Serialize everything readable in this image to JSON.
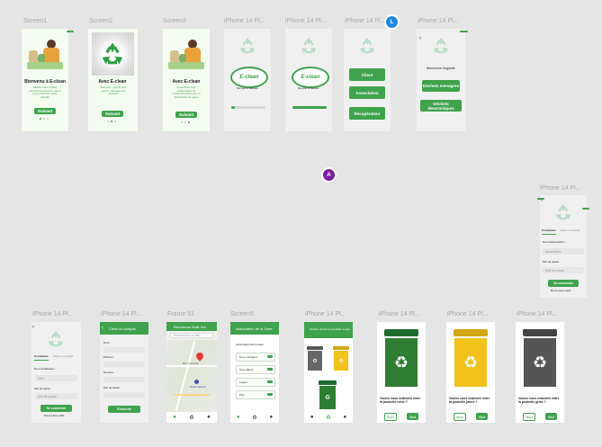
{
  "labels": {
    "screen1": "Screen1",
    "screen2": "Screen2",
    "screen3": "Screen3",
    "iphone1": "iPhone 14 Pl...",
    "iphone2": "iPhone 14 Pl...",
    "iphone3": "iPhone 14 Pl...",
    "iphone4": "iPhone 14 Pl...",
    "iphone_right": "iPhone 14 Pl...",
    "iphone5": "iPhone 14 Pl...",
    "iphone6": "iPhone 14 Pl...",
    "frame51": "Frame 51",
    "screen5": "Screen5",
    "iphone7": "iPhone 14 Pl...",
    "iphone8": "iPhone 14 Pl...",
    "iphone9": "iPhone 14 Pl...",
    "iphone10": "iPhone 14 Pl..."
  },
  "avatars": {
    "l": "L",
    "a": "A"
  },
  "colors": {
    "green": "#3fa34d",
    "avatar_l": "#1e88e5",
    "avatar_a": "#7b1fa2",
    "canvas": "#e5e5e5"
  },
  "onboarding": {
    "s1_title": "Bienvenu à E-clean",
    "s1_body": "Mettre votre impact environnemental en valeur pour préserver notre planète",
    "s2_title": "Avec E-clean",
    "s2_body": "Recycler, gagner des points, valoriser des déchets",
    "s3_title": "Avec E-clean",
    "s3_body": "Contribuez à la préservation de l'environnement tout en bénéficiant de gains",
    "next": "Suivant"
  },
  "logo_text": "E-clean",
  "logo_tagline": "Recyclez et valorisez",
  "roles": {
    "client": "Client",
    "association": "Association",
    "recuperateur": "Récupérateur"
  },
  "welcome": {
    "greeting": "Bienvenue Huguette",
    "menagers": "Déchets ménagers",
    "electroniques": "Déchets électroniques"
  },
  "login_right": {
    "tab_login": "Connexion",
    "tab_create": "Créer un compte",
    "name_label": "Nom d'association :",
    "name_ph": "Association",
    "pass_label": "Mot de passe :",
    "pass_ph": "Mot de passe",
    "submit": "Se connecter",
    "forgot": "Mot de passe oublié"
  },
  "login_left": {
    "tab_login": "Connexion",
    "tab_create": "Créer un compte",
    "user_label": "Nom d'utilisateur :",
    "user_ph": "Nom",
    "pass_label": "Mot de passe :",
    "pass_ph": "Mot de passe",
    "submit": "Se connecter",
    "forgot": "Mot de passe oublié"
  },
  "signup": {
    "title": "Créer un compte",
    "nom": "Nom :",
    "prenom": "Prénom :",
    "numero": "Numéro :",
    "pass": "Mot de passe :",
    "submit": "S'inscrire"
  },
  "map": {
    "header": "Bienvenue Sidik Sia",
    "search": "Rechercher un lieu",
    "place": "Mont Cameroun",
    "poi": "Musée National"
  },
  "assoc": {
    "title": "Association de la Zone",
    "heading": "Association ECO-clean",
    "rows": [
      "Tous ménagers",
      "Tous débris",
      "Légère",
      "Plus"
    ]
  },
  "choose_bin": {
    "header": "Veuillez choisir la poubelle à vider"
  },
  "bins": {
    "green_q": "Voulez vous vraiment vider la poubelle verte ?",
    "yellow_q": "Voulez vous vraiment vider la poubelle jaune ?",
    "grey_q": "Voulez vous vraiment vider la poubelle grise ?",
    "no": "Non",
    "yes": "Oui"
  }
}
